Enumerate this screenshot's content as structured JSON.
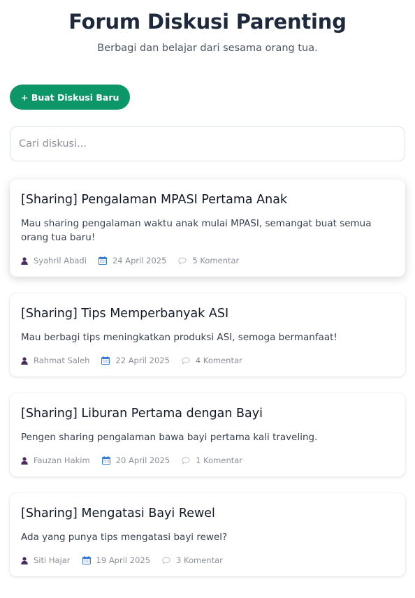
{
  "header": {
    "title": "Forum Diskusi Parenting",
    "subtitle": "Berbagi dan belajar dari sesama orang tua."
  },
  "actions": {
    "new_discussion_label": "+ Buat Diskusi Baru"
  },
  "search": {
    "placeholder": "Cari diskusi...",
    "value": ""
  },
  "colors": {
    "accent": "#0d9668",
    "user_icon": "#4a2c5e",
    "calendar_icon": "#3b7fd4"
  },
  "icons": {
    "author": "user-icon",
    "date": "calendar-icon",
    "comments": "comment-bubble-icon"
  },
  "posts": [
    {
      "title": "[Sharing] Pengalaman MPASI Pertama Anak",
      "excerpt": "Mau sharing pengalaman waktu anak mulai MPASI, semangat buat semua orang tua baru!",
      "author": "Syahril Abadi",
      "date": "24 April 2025",
      "comments": "5 Komentar"
    },
    {
      "title": "[Sharing] Tips Memperbanyak ASI",
      "excerpt": "Mau berbagi tips meningkatkan produksi ASI, semoga bermanfaat!",
      "author": "Rahmat Saleh",
      "date": "22 April 2025",
      "comments": "4 Komentar"
    },
    {
      "title": "[Sharing] Liburan Pertama dengan Bayi",
      "excerpt": "Pengen sharing pengalaman bawa bayi pertama kali traveling.",
      "author": "Fauzan Hakim",
      "date": "20 April 2025",
      "comments": "1 Komentar"
    },
    {
      "title": "[Sharing] Mengatasi Bayi Rewel",
      "excerpt": "Ada yang punya tips mengatasi bayi rewel?",
      "author": "Siti Hajar",
      "date": "19 April 2025",
      "comments": "3 Komentar"
    }
  ]
}
